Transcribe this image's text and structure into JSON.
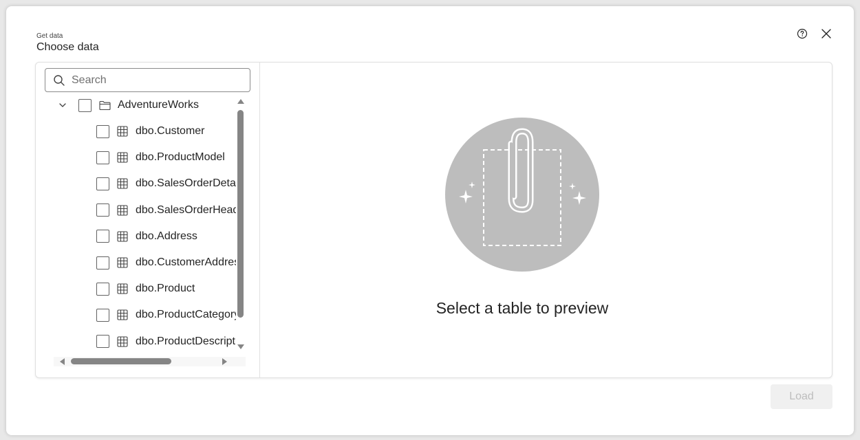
{
  "header": {
    "subtitle": "Get data",
    "title": "Choose data"
  },
  "search": {
    "placeholder": "Search",
    "value": ""
  },
  "tree": {
    "root": {
      "label": "AdventureWorks",
      "expanded": true
    },
    "items": [
      {
        "label": "dbo.Customer"
      },
      {
        "label": "dbo.ProductModel"
      },
      {
        "label": "dbo.SalesOrderDetail"
      },
      {
        "label": "dbo.SalesOrderHeader"
      },
      {
        "label": "dbo.Address"
      },
      {
        "label": "dbo.CustomerAddress"
      },
      {
        "label": "dbo.Product"
      },
      {
        "label": "dbo.ProductCategory"
      },
      {
        "label": "dbo.ProductDescription"
      }
    ]
  },
  "preview": {
    "empty_message": "Select a table to preview"
  },
  "footer": {
    "load_label": "Load"
  },
  "icons": {
    "help": "question-circle-icon",
    "close": "close-icon",
    "search": "search-icon",
    "folder": "folder-icon",
    "table": "table-grid-icon",
    "preview": "paperclip-illustration"
  },
  "colors": {
    "illustration_circle": "#bdbdbd",
    "load_disabled_bg": "#f0f0f0",
    "load_disabled_text": "#bdbdbd"
  }
}
